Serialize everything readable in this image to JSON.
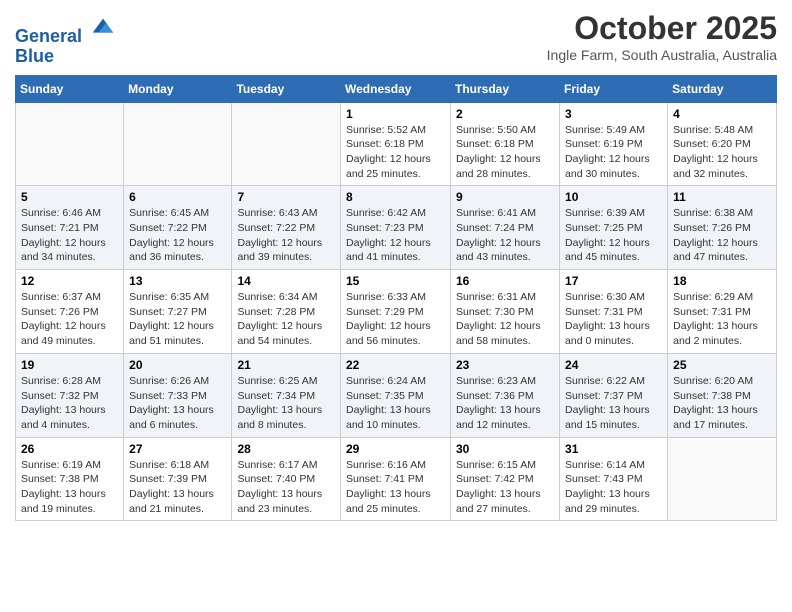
{
  "header": {
    "logo_line1": "General",
    "logo_line2": "Blue",
    "title": "October 2025",
    "subtitle": "Ingle Farm, South Australia, Australia"
  },
  "days_of_week": [
    "Sunday",
    "Monday",
    "Tuesday",
    "Wednesday",
    "Thursday",
    "Friday",
    "Saturday"
  ],
  "weeks": [
    [
      {
        "num": "",
        "info": ""
      },
      {
        "num": "",
        "info": ""
      },
      {
        "num": "",
        "info": ""
      },
      {
        "num": "1",
        "info": "Sunrise: 5:52 AM\nSunset: 6:18 PM\nDaylight: 12 hours\nand 25 minutes."
      },
      {
        "num": "2",
        "info": "Sunrise: 5:50 AM\nSunset: 6:18 PM\nDaylight: 12 hours\nand 28 minutes."
      },
      {
        "num": "3",
        "info": "Sunrise: 5:49 AM\nSunset: 6:19 PM\nDaylight: 12 hours\nand 30 minutes."
      },
      {
        "num": "4",
        "info": "Sunrise: 5:48 AM\nSunset: 6:20 PM\nDaylight: 12 hours\nand 32 minutes."
      }
    ],
    [
      {
        "num": "5",
        "info": "Sunrise: 6:46 AM\nSunset: 7:21 PM\nDaylight: 12 hours\nand 34 minutes."
      },
      {
        "num": "6",
        "info": "Sunrise: 6:45 AM\nSunset: 7:22 PM\nDaylight: 12 hours\nand 36 minutes."
      },
      {
        "num": "7",
        "info": "Sunrise: 6:43 AM\nSunset: 7:22 PM\nDaylight: 12 hours\nand 39 minutes."
      },
      {
        "num": "8",
        "info": "Sunrise: 6:42 AM\nSunset: 7:23 PM\nDaylight: 12 hours\nand 41 minutes."
      },
      {
        "num": "9",
        "info": "Sunrise: 6:41 AM\nSunset: 7:24 PM\nDaylight: 12 hours\nand 43 minutes."
      },
      {
        "num": "10",
        "info": "Sunrise: 6:39 AM\nSunset: 7:25 PM\nDaylight: 12 hours\nand 45 minutes."
      },
      {
        "num": "11",
        "info": "Sunrise: 6:38 AM\nSunset: 7:26 PM\nDaylight: 12 hours\nand 47 minutes."
      }
    ],
    [
      {
        "num": "12",
        "info": "Sunrise: 6:37 AM\nSunset: 7:26 PM\nDaylight: 12 hours\nand 49 minutes."
      },
      {
        "num": "13",
        "info": "Sunrise: 6:35 AM\nSunset: 7:27 PM\nDaylight: 12 hours\nand 51 minutes."
      },
      {
        "num": "14",
        "info": "Sunrise: 6:34 AM\nSunset: 7:28 PM\nDaylight: 12 hours\nand 54 minutes."
      },
      {
        "num": "15",
        "info": "Sunrise: 6:33 AM\nSunset: 7:29 PM\nDaylight: 12 hours\nand 56 minutes."
      },
      {
        "num": "16",
        "info": "Sunrise: 6:31 AM\nSunset: 7:30 PM\nDaylight: 12 hours\nand 58 minutes."
      },
      {
        "num": "17",
        "info": "Sunrise: 6:30 AM\nSunset: 7:31 PM\nDaylight: 13 hours\nand 0 minutes."
      },
      {
        "num": "18",
        "info": "Sunrise: 6:29 AM\nSunset: 7:31 PM\nDaylight: 13 hours\nand 2 minutes."
      }
    ],
    [
      {
        "num": "19",
        "info": "Sunrise: 6:28 AM\nSunset: 7:32 PM\nDaylight: 13 hours\nand 4 minutes."
      },
      {
        "num": "20",
        "info": "Sunrise: 6:26 AM\nSunset: 7:33 PM\nDaylight: 13 hours\nand 6 minutes."
      },
      {
        "num": "21",
        "info": "Sunrise: 6:25 AM\nSunset: 7:34 PM\nDaylight: 13 hours\nand 8 minutes."
      },
      {
        "num": "22",
        "info": "Sunrise: 6:24 AM\nSunset: 7:35 PM\nDaylight: 13 hours\nand 10 minutes."
      },
      {
        "num": "23",
        "info": "Sunrise: 6:23 AM\nSunset: 7:36 PM\nDaylight: 13 hours\nand 12 minutes."
      },
      {
        "num": "24",
        "info": "Sunrise: 6:22 AM\nSunset: 7:37 PM\nDaylight: 13 hours\nand 15 minutes."
      },
      {
        "num": "25",
        "info": "Sunrise: 6:20 AM\nSunset: 7:38 PM\nDaylight: 13 hours\nand 17 minutes."
      }
    ],
    [
      {
        "num": "26",
        "info": "Sunrise: 6:19 AM\nSunset: 7:38 PM\nDaylight: 13 hours\nand 19 minutes."
      },
      {
        "num": "27",
        "info": "Sunrise: 6:18 AM\nSunset: 7:39 PM\nDaylight: 13 hours\nand 21 minutes."
      },
      {
        "num": "28",
        "info": "Sunrise: 6:17 AM\nSunset: 7:40 PM\nDaylight: 13 hours\nand 23 minutes."
      },
      {
        "num": "29",
        "info": "Sunrise: 6:16 AM\nSunset: 7:41 PM\nDaylight: 13 hours\nand 25 minutes."
      },
      {
        "num": "30",
        "info": "Sunrise: 6:15 AM\nSunset: 7:42 PM\nDaylight: 13 hours\nand 27 minutes."
      },
      {
        "num": "31",
        "info": "Sunrise: 6:14 AM\nSunset: 7:43 PM\nDaylight: 13 hours\nand 29 minutes."
      },
      {
        "num": "",
        "info": ""
      }
    ]
  ]
}
